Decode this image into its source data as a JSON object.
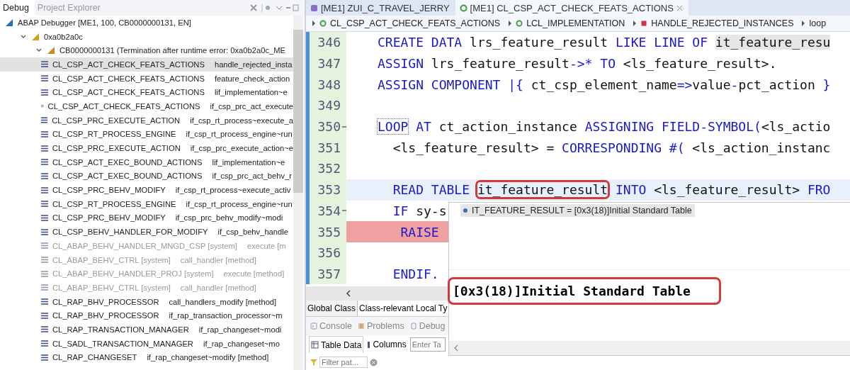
{
  "debug_view": {
    "tabs": [
      {
        "label": "Debug",
        "selected": true
      },
      {
        "label": "Project Explorer",
        "selected": false
      }
    ],
    "tree": [
      {
        "label": "ABAP Debugger [ME1, 100, CB0000000131, EN]",
        "kind": "debugger",
        "children": [
          {
            "label": "0xa0b2a0c",
            "kind": "process",
            "expanded": true,
            "children": [
              {
                "label": "CB0000000131 (Termination after runtime error: 0xa0b2a0c_ME",
                "kind": "session",
                "expanded": true,
                "children": [
                  {
                    "kind": "frame",
                    "class": "CL_CSP_ACT_CHECK_FEATS_ACTIONS",
                    "method": "handle_rejected_insta",
                    "selected": true,
                    "dimmed": false
                  },
                  {
                    "kind": "frame",
                    "class": "CL_CSP_ACT_CHECK_FEATS_ACTIONS",
                    "method": "feature_check_action",
                    "selected": false,
                    "dimmed": false
                  },
                  {
                    "kind": "frame",
                    "class": "CL_CSP_ACT_CHECK_FEATS_ACTIONS",
                    "method": "lif_implementation~e",
                    "selected": false,
                    "dimmed": false
                  },
                  {
                    "kind": "frame",
                    "class": "CL_CSP_ACT_CHECK_FEATS_ACTIONS",
                    "method": "if_csp_prc_act_execute",
                    "selected": false,
                    "dimmed": false
                  },
                  {
                    "kind": "frame",
                    "class": "CL_CSP_PRC_EXECUTE_ACTION",
                    "method": "if_csp_rt_process~execute_a",
                    "selected": false,
                    "dimmed": false
                  },
                  {
                    "kind": "frame",
                    "class": "CL_CSP_RT_PROCESS_ENGINE",
                    "method": "if_csp_rt_process_engine~run",
                    "selected": false,
                    "dimmed": false
                  },
                  {
                    "kind": "frame",
                    "class": "CL_CSP_PRC_EXECUTE_ACTION",
                    "method": "if_csp_prc_execute_action~e",
                    "selected": false,
                    "dimmed": false
                  },
                  {
                    "kind": "frame",
                    "class": "CL_CSP_ACT_EXEC_BOUND_ACTIONS",
                    "method": "lif_implementation~e",
                    "selected": false,
                    "dimmed": false
                  },
                  {
                    "kind": "frame",
                    "class": "CL_CSP_ACT_EXEC_BOUND_ACTIONS",
                    "method": "if_csp_prc_act_behv_r",
                    "selected": false,
                    "dimmed": false
                  },
                  {
                    "kind": "frame",
                    "class": "CL_CSP_PRC_BEHV_MODIFY",
                    "method": "if_csp_rt_process~execute_activ",
                    "selected": false,
                    "dimmed": false
                  },
                  {
                    "kind": "frame",
                    "class": "CL_CSP_RT_PROCESS_ENGINE",
                    "method": "if_csp_rt_process_engine~run",
                    "selected": false,
                    "dimmed": false
                  },
                  {
                    "kind": "frame",
                    "class": "CL_CSP_PRC_BEHV_MODIFY",
                    "method": "if_csp_prc_behv_modify~modi",
                    "selected": false,
                    "dimmed": false
                  },
                  {
                    "kind": "frame",
                    "class": "CL_CSP_BEHV_HANDLER_FOR_MODIFY",
                    "method": "if_csp_behv_handle",
                    "selected": false,
                    "dimmed": false
                  },
                  {
                    "kind": "frame",
                    "class": "CL_ABAP_BEHV_HANDLER_MNGD_CSP [system]",
                    "method": "execute [m",
                    "selected": false,
                    "dimmed": true
                  },
                  {
                    "kind": "frame",
                    "class": "CL_ABAP_BEHV_CTRL [system]",
                    "method": "call_handler [method]",
                    "selected": false,
                    "dimmed": true
                  },
                  {
                    "kind": "frame",
                    "class": "CL_ABAP_BEHV_HANDLER_PROJ [system]",
                    "method": "execute [method]",
                    "selected": false,
                    "dimmed": true
                  },
                  {
                    "kind": "frame",
                    "class": "CL_ABAP_BEHV_CTRL [system]",
                    "method": "call_handler [method]",
                    "selected": false,
                    "dimmed": true
                  },
                  {
                    "kind": "frame",
                    "class": "CL_RAP_BHV_PROCESSOR",
                    "method": "call_handlers_modify [method]",
                    "selected": false,
                    "dimmed": false
                  },
                  {
                    "kind": "frame",
                    "class": "CL_RAP_BHV_PROCESSOR",
                    "method": "if_rap_transaction_processor~m",
                    "selected": false,
                    "dimmed": false
                  },
                  {
                    "kind": "frame",
                    "class": "CL_RAP_TRANSACTION_MANAGER",
                    "method": "if_rap_changeset~modi",
                    "selected": false,
                    "dimmed": false
                  },
                  {
                    "kind": "frame",
                    "class": "CL_SADL_TRANSACTION_MANAGER",
                    "method": "if_rap_changeset~mo",
                    "selected": false,
                    "dimmed": false
                  },
                  {
                    "kind": "frame",
                    "class": "CL_RAP_CHANGESET",
                    "method": "if_rap_changeset~modify [method]",
                    "selected": false,
                    "dimmed": false
                  }
                ]
              }
            ]
          }
        ]
      }
    ]
  },
  "editor": {
    "tabs": [
      {
        "label": "[ME1] ZUI_C_TRAVEL_JERRY",
        "kind": "behavior",
        "selected": false
      },
      {
        "label": "[ME1] CL_CSP_ACT_CHECK_FEATS_ACTIONS",
        "kind": "class",
        "selected": true
      }
    ],
    "breadcrumb": [
      {
        "label": "CL_CSP_ACT_CHECK_FEATS_ACTIONS",
        "kind": "class"
      },
      {
        "label": "LCL_IMPLEMENTATION",
        "kind": "local-class"
      },
      {
        "label": "HANDLE_REJECTED_INSTANCES",
        "kind": "method"
      },
      {
        "label": "loop",
        "kind": "block"
      }
    ],
    "lines": [
      {
        "number": "346",
        "current": false,
        "error": false,
        "foldable": false,
        "segments": [
          {
            "text": "CREATE DATA",
            "kind": "keyword"
          },
          {
            "text": " lrs_feature_result ",
            "kind": "ident"
          },
          {
            "text": "LIKE LINE OF ",
            "kind": "keyword"
          },
          {
            "text": "it_feature_resu",
            "kind": "ident",
            "occurrence": true
          }
        ]
      },
      {
        "number": "347",
        "current": false,
        "error": false,
        "foldable": false,
        "segments": [
          {
            "text": "ASSIGN",
            "kind": "keyword"
          },
          {
            "text": " lrs_feature_result",
            "kind": "ident"
          },
          {
            "text": "->*",
            "kind": "keyword"
          },
          {
            "text": " TO",
            "kind": "keyword"
          },
          {
            "text": " <ls_feature_result>.",
            "kind": "ident"
          }
        ]
      },
      {
        "number": "348",
        "current": false,
        "error": false,
        "foldable": false,
        "segments": [
          {
            "text": "ASSIGN COMPONENT |{",
            "kind": "keyword"
          },
          {
            "text": " ct_csp_element_name",
            "kind": "ident"
          },
          {
            "text": "=>",
            "kind": "keyword"
          },
          {
            "text": "value",
            "kind": "ident"
          },
          {
            "text": "-",
            "kind": "keyword"
          },
          {
            "text": "pct_action ",
            "kind": "ident"
          },
          {
            "text": "}",
            "kind": "keyword"
          }
        ]
      },
      {
        "number": "349",
        "current": false,
        "error": false,
        "foldable": false
      },
      {
        "number": "350",
        "current": false,
        "error": false,
        "foldable": true,
        "segments": [
          {
            "text": "LOOP",
            "kind": "keyword",
            "matched": true
          },
          {
            "text": " AT",
            "kind": "keyword"
          },
          {
            "text": " ct_action_instance ",
            "kind": "ident"
          },
          {
            "text": "ASSIGNING FIELD-SYMBOL(",
            "kind": "keyword"
          },
          {
            "text": "<ls_actio",
            "kind": "ident"
          }
        ]
      },
      {
        "number": "351",
        "current": false,
        "error": false,
        "foldable": false,
        "segments": [
          {
            "text": "  <ls_feature_result> = ",
            "kind": "ident"
          },
          {
            "text": "CORRESPONDING #(",
            "kind": "keyword"
          },
          {
            "text": " <ls_action_instanc",
            "kind": "ident"
          }
        ]
      },
      {
        "number": "352",
        "current": false,
        "error": false,
        "foldable": false
      },
      {
        "number": "353",
        "current": true,
        "error": false,
        "foldable": false,
        "segments": [
          {
            "text": "  READ TABLE ",
            "kind": "keyword"
          },
          {
            "text": "it_feature_result",
            "kind": "ident",
            "marked": true
          },
          {
            "text": " INTO ",
            "kind": "keyword"
          },
          {
            "text": "<ls_feature_result> ",
            "kind": "ident"
          },
          {
            "text": "FRO",
            "kind": "keyword"
          }
        ]
      },
      {
        "number": "354",
        "current": false,
        "error": false,
        "foldable": true,
        "segments": [
          {
            "text": "  IF",
            "kind": "keyword"
          },
          {
            "text": " sy-s",
            "kind": "ident"
          }
        ]
      },
      {
        "number": "355",
        "current": false,
        "error": true,
        "foldable": false,
        "segments": [
          {
            "text": "   RAISE",
            "kind": "keyword"
          }
        ]
      },
      {
        "number": "356",
        "current": false,
        "error": false,
        "foldable": false
      },
      {
        "number": "357",
        "current": false,
        "error": false,
        "foldable": false,
        "segments": [
          {
            "text": "  ENDIF.",
            "kind": "keyword"
          }
        ]
      }
    ],
    "class_tabs": [
      {
        "label": "Global Class",
        "selected": true
      },
      {
        "label": "Class-relevant Local Ty",
        "selected": false
      }
    ]
  },
  "bottom_panel": {
    "tabs": [
      {
        "label": "Console",
        "kind": "console"
      },
      {
        "label": "Problems",
        "kind": "problems"
      },
      {
        "label": "Debug",
        "kind": "debug"
      }
    ],
    "subtabs": [
      {
        "label": "Table Data",
        "kind": "table",
        "selected": true
      },
      {
        "label": "Columns",
        "kind": "columns",
        "selected": false
      }
    ],
    "table_field": {
      "placeholder": "Enter Ta"
    },
    "filter_field": {
      "placeholder": "Filter pat..."
    }
  },
  "hover_popup": {
    "header": "IT_FEATURE_RESULT = [0x3(18)]Initial Standard Table",
    "value": "[0x3(18)]Initial Standard Table"
  }
}
